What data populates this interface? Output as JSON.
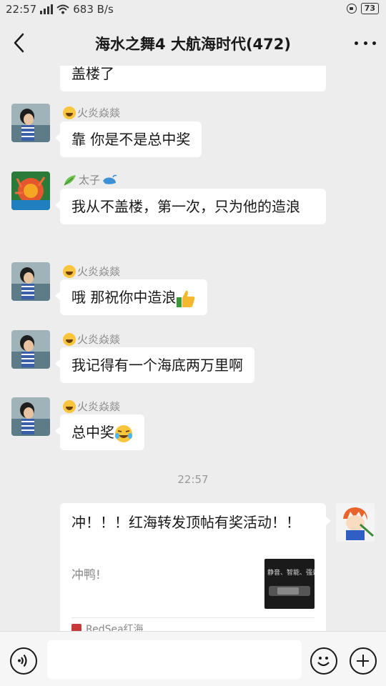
{
  "status_bar": {
    "time": "22:57",
    "network_speed": "683 B/s",
    "battery": "73"
  },
  "header": {
    "title": "海水之舞4 大航海时代(472)",
    "back_icon": "chevron-left-icon",
    "more_icon": "more-dots-icon"
  },
  "messages": [
    {
      "text": "盖楼了"
    },
    {
      "sender": "火炎焱燚",
      "text": "靠  你是不是总中奖"
    },
    {
      "sender": "太子",
      "text": "我从不盖楼，第一次，只为他的造浪"
    },
    {
      "sender": "火炎焱燚",
      "text": "哦  那祝你中造浪"
    },
    {
      "sender": "火炎焱燚",
      "text": "我记得有一个海底两万里啊"
    },
    {
      "sender": "火炎焱燚",
      "text": "总中奖"
    }
  ],
  "timestamp": "22:57",
  "card": {
    "title": "冲！！！红海转发顶帖有奖活动！！",
    "description": "冲鸭!",
    "thumb_text": "静音、智能、强劲",
    "source": "RedSea红海"
  },
  "input_bar": {
    "placeholder": "",
    "voice_icon": "voice-icon",
    "emoji_icon": "emoji-icon",
    "plus_icon": "plus-icon"
  },
  "colors": {
    "background": "#ededed",
    "bubble": "#ffffff",
    "text": "#191919",
    "nickname": "#888888"
  }
}
